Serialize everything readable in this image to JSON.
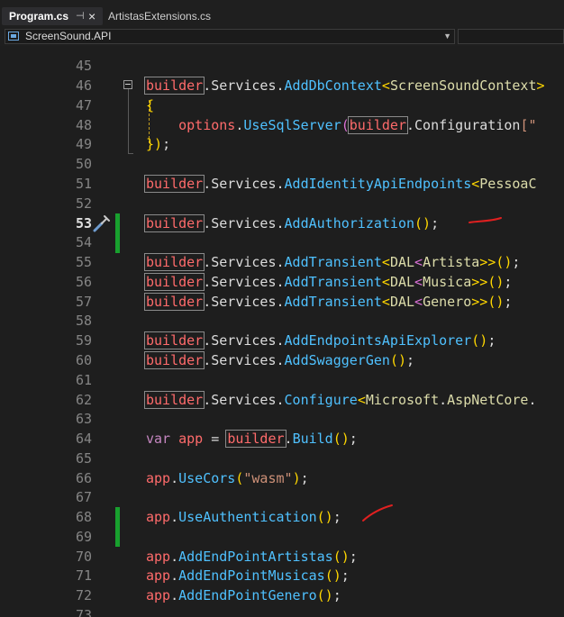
{
  "tabs": [
    {
      "label": "Program.cs",
      "active": true
    },
    {
      "label": "ArtistasExtensions.cs",
      "active": false
    }
  ],
  "navigation": {
    "project": "ScreenSound.API"
  },
  "icons": {
    "pin": "pin-icon",
    "close": "close-icon",
    "project": "csharp-project-icon",
    "quick_actions": "screwdriver-icon"
  },
  "colors": {
    "change_marker": "#18a02e",
    "annotation_ink": "#e02020"
  },
  "line_numbers": [
    "45",
    "46",
    "47",
    "48",
    "49",
    "50",
    "51",
    "52",
    "53",
    "54",
    "55",
    "56",
    "57",
    "58",
    "59",
    "60",
    "61",
    "62",
    "63",
    "64",
    "65",
    "66",
    "67",
    "68",
    "69",
    "70",
    "71",
    "72",
    "73"
  ],
  "code": {
    "l46": {
      "t1": "builder",
      "t2": ".",
      "t3": "Services",
      "t4": ".",
      "t5": "AddDbContext",
      "t6": "<",
      "t7": "ScreenSoundContext",
      "t8": ">"
    },
    "l47": {
      "t1": "{"
    },
    "l48": {
      "t1": "options",
      "t2": ".",
      "t3": "UseSqlServer",
      "t4": "(",
      "t5": "builder",
      "t6": ".",
      "t7": "Configuration",
      "t8": "[\""
    },
    "l49": {
      "t1": "}",
      "t2": ")",
      "t3": ";"
    },
    "l51": {
      "t1": "builder",
      "t2": ".",
      "t3": "Services",
      "t4": ".",
      "t5": "AddIdentityApiEndpoints",
      "t6": "<",
      "t7": "PessoaC"
    },
    "l53": {
      "t1": "builder",
      "t2": ".",
      "t3": "Services",
      "t4": ".",
      "t5": "AddAuthorization",
      "t6": "()",
      "t7": ";"
    },
    "l55": {
      "t1": "builder",
      "t2": ".",
      "t3": "Services",
      "t4": ".",
      "t5": "AddTransient",
      "t6": "<",
      "t7": "DAL",
      "t8": "<",
      "t9": "Artista",
      "t10": ">>",
      "t11": "()",
      "t12": ";"
    },
    "l56": {
      "t1": "builder",
      "t2": ".",
      "t3": "Services",
      "t4": ".",
      "t5": "AddTransient",
      "t6": "<",
      "t7": "DAL",
      "t8": "<",
      "t9": "Musica",
      "t10": ">>",
      "t11": "()",
      "t12": ";"
    },
    "l57": {
      "t1": "builder",
      "t2": ".",
      "t3": "Services",
      "t4": ".",
      "t5": "AddTransient",
      "t6": "<",
      "t7": "DAL",
      "t8": "<",
      "t9": "Genero",
      "t10": ">>",
      "t11": "()",
      "t12": ";"
    },
    "l59": {
      "t1": "builder",
      "t2": ".",
      "t3": "Services",
      "t4": ".",
      "t5": "AddEndpointsApiExplorer",
      "t6": "()",
      "t7": ";"
    },
    "l60": {
      "t1": "builder",
      "t2": ".",
      "t3": "Services",
      "t4": ".",
      "t5": "AddSwaggerGen",
      "t6": "()",
      "t7": ";"
    },
    "l62": {
      "t1": "builder",
      "t2": ".",
      "t3": "Services",
      "t4": ".",
      "t5": "Configure",
      "t6": "<",
      "t7": "Microsoft",
      "t8": ".",
      "t9": "AspNetCore",
      "t10": "."
    },
    "l64": {
      "t1": "var",
      "t2": " ",
      "t3": "app",
      "t4": " = ",
      "t5": "builder",
      "t6": ".",
      "t7": "Build",
      "t8": "()",
      "t9": ";"
    },
    "l66": {
      "t1": "app",
      "t2": ".",
      "t3": "UseCors",
      "t4": "(",
      "t5": "\"wasm\"",
      "t6": ")",
      "t7": ";"
    },
    "l68": {
      "t1": "app",
      "t2": ".",
      "t3": "UseAuthentication",
      "t4": "()",
      "t5": ";"
    },
    "l70": {
      "t1": "app",
      "t2": ".",
      "t3": "AddEndPointArtistas",
      "t4": "()",
      "t5": ";"
    },
    "l71": {
      "t1": "app",
      "t2": ".",
      "t3": "AddEndPointMusicas",
      "t4": "()",
      "t5": ";"
    },
    "l72": {
      "t1": "app",
      "t2": ".",
      "t3": "AddEndPointGenero",
      "t4": "()",
      "t5": ";"
    }
  }
}
